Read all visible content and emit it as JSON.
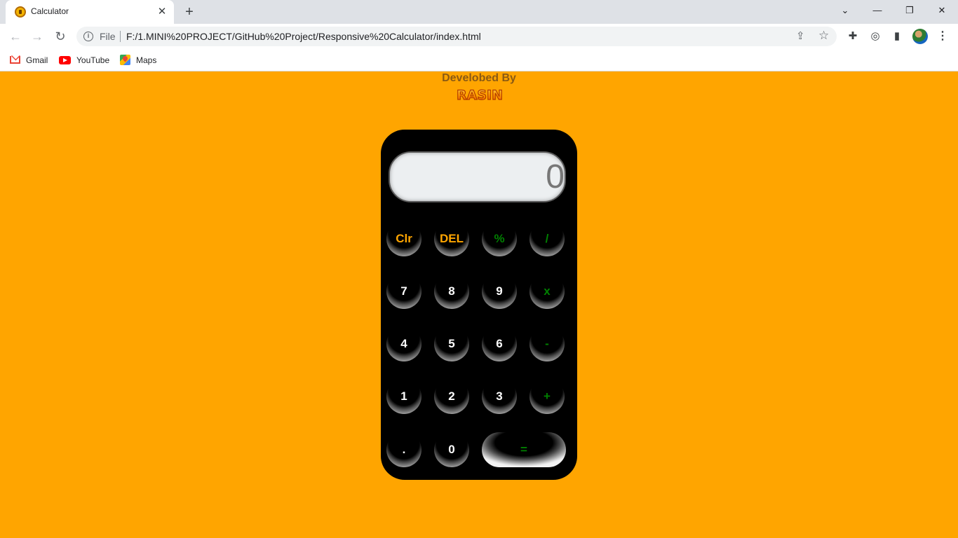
{
  "browser": {
    "tab_title": "Calculator",
    "url_scheme": "File",
    "url": "F:/1.MINI%20PROJECT/GitHub%20Project/Responsive%20Calculator/index.html",
    "bookmarks": [
      {
        "label": "Gmail",
        "icon": "gmail-icon"
      },
      {
        "label": "YouTube",
        "icon": "youtube-icon"
      },
      {
        "label": "Maps",
        "icon": "maps-icon"
      }
    ]
  },
  "page": {
    "dev_label": "Develobed By",
    "logo_text": "RASIN",
    "background_color": "#ffa500"
  },
  "calculator": {
    "display_value": "0",
    "keys": {
      "clear": "Clr",
      "delete": "DEL",
      "percent": "%",
      "divide": "/",
      "seven": "7",
      "eight": "8",
      "nine": "9",
      "multiply": "x",
      "four": "4",
      "five": "5",
      "six": "6",
      "minus": "-",
      "one": "1",
      "two": "2",
      "three": "3",
      "plus": "+",
      "dot": ".",
      "zero": "0",
      "equals": "="
    },
    "colors": {
      "digit": "#ffffff",
      "operator": "#008000",
      "function": "#ffa500",
      "body": "#000000"
    }
  }
}
